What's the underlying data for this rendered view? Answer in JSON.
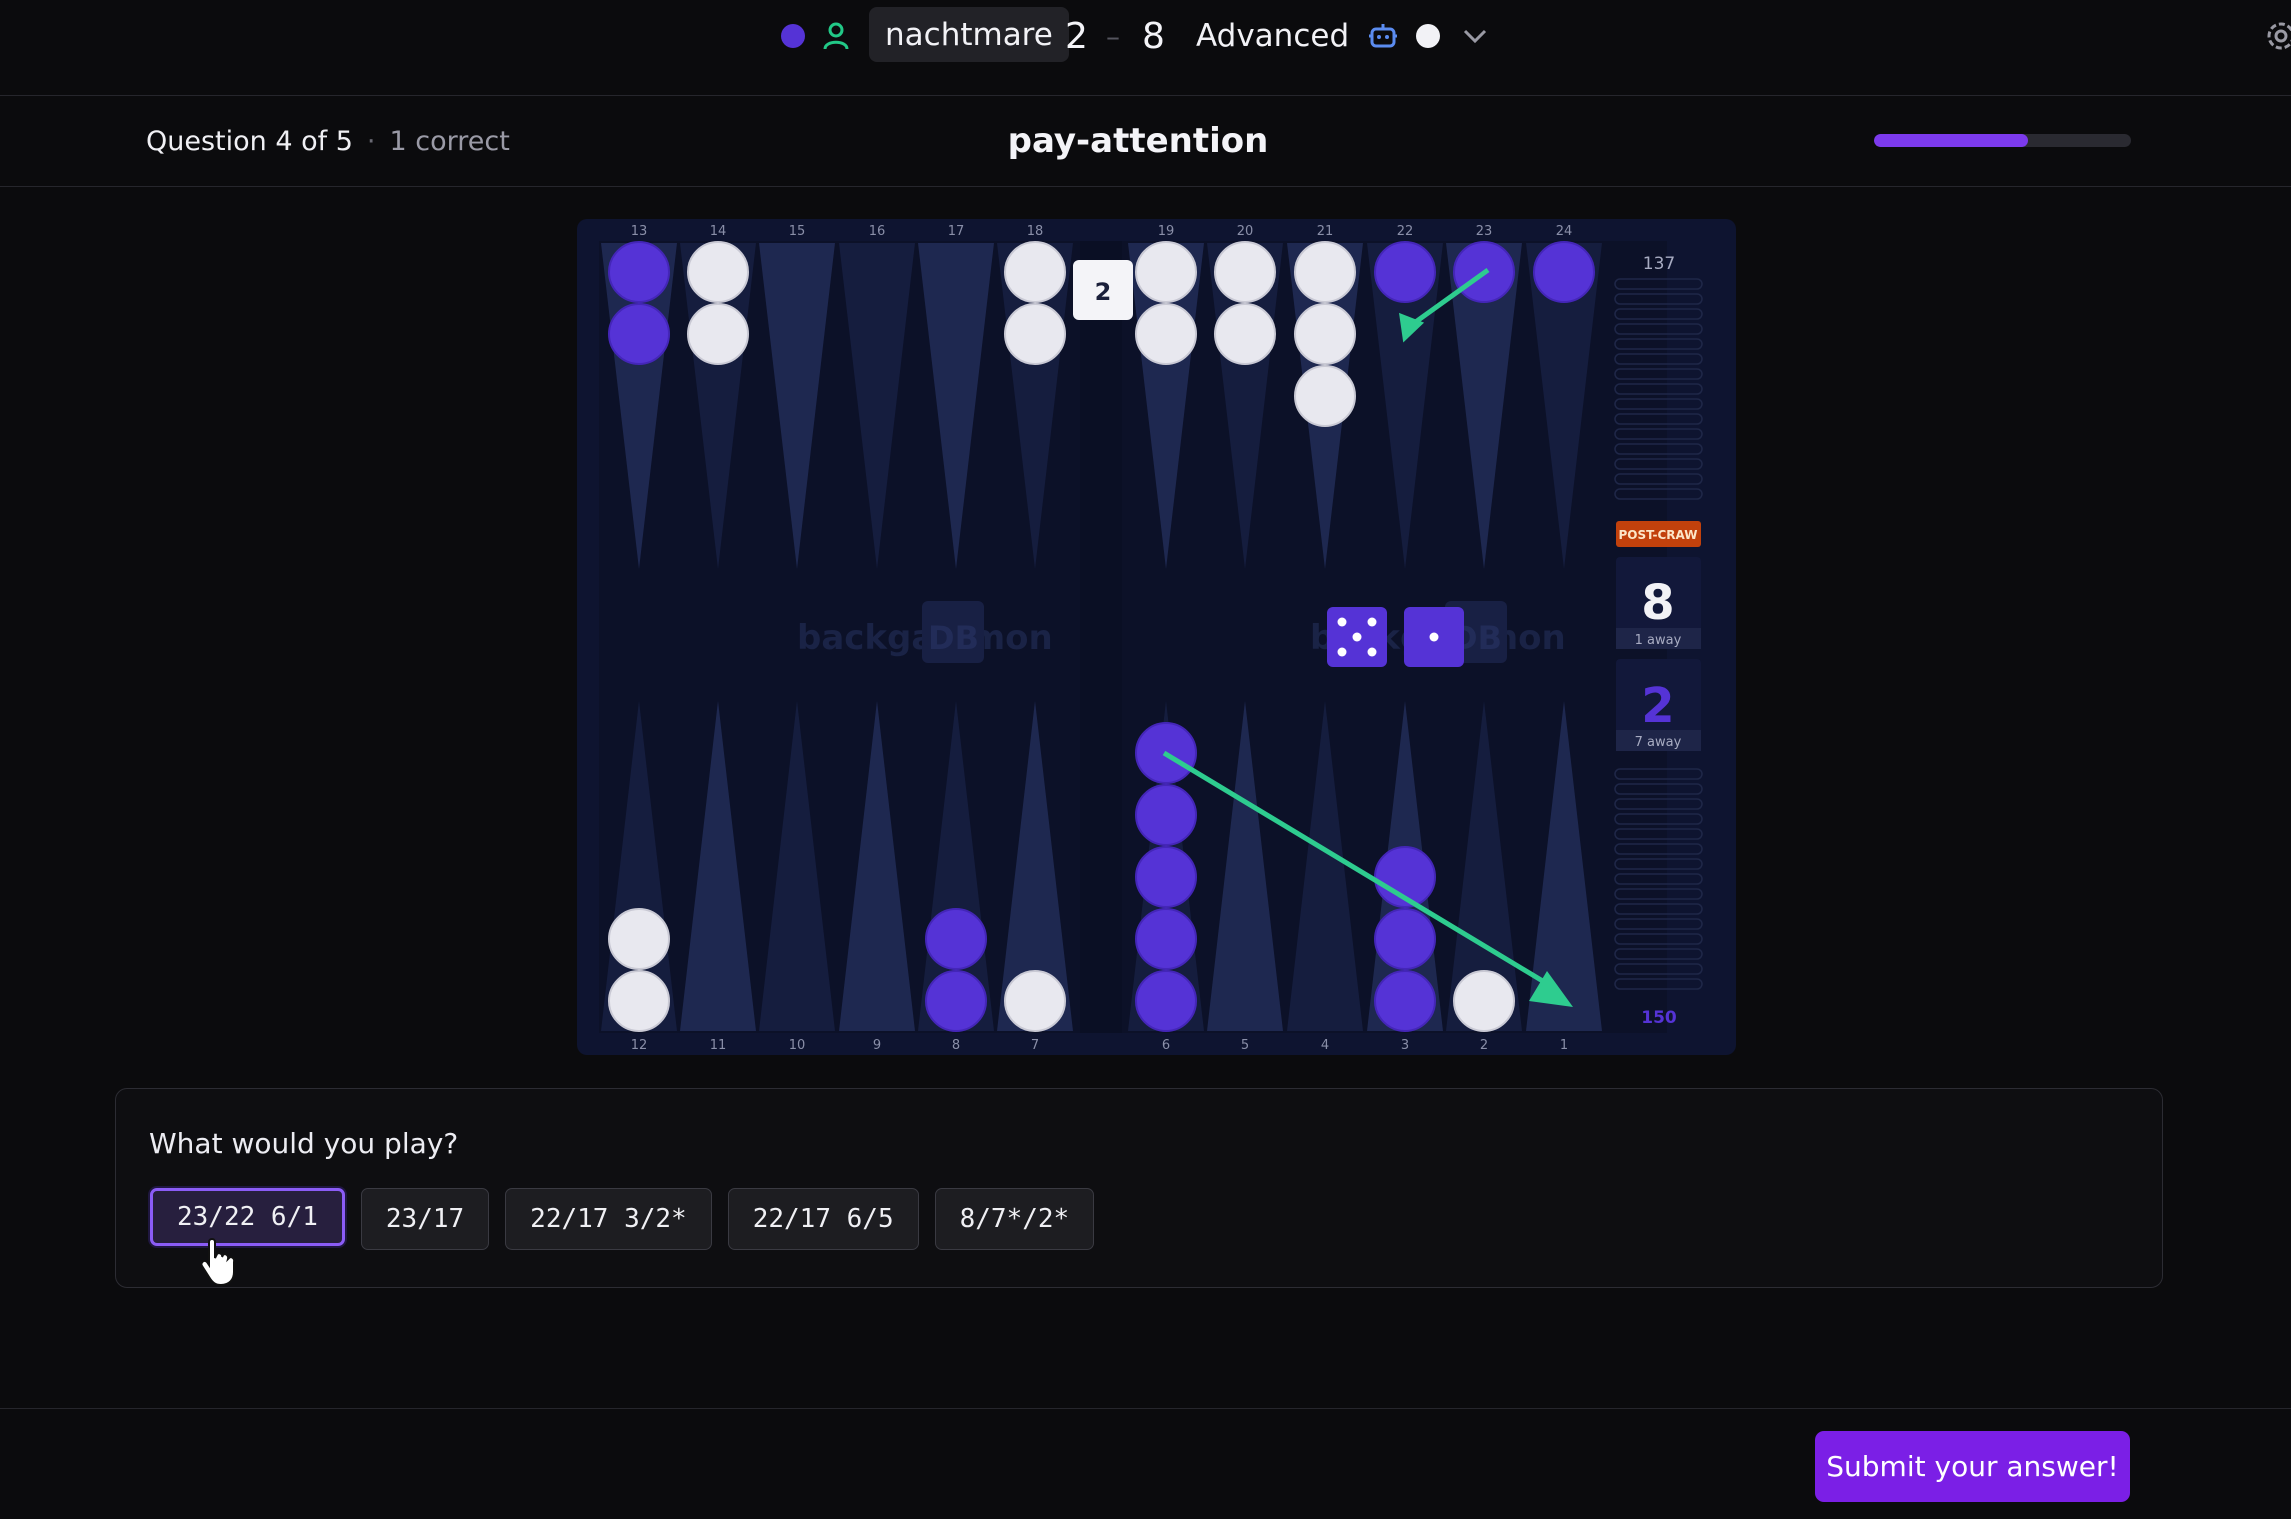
{
  "header": {
    "player_name": "nachtmare",
    "score_player": "2",
    "score_dash": "–",
    "score_opponent": "8",
    "level": "Advanced"
  },
  "question": {
    "progress_label": "Question 4 of 5",
    "separator": "·",
    "correct_label": "1 correct",
    "title": "pay-attention",
    "progress_fraction": 0.6
  },
  "board": {
    "top_points": [
      "13",
      "14",
      "15",
      "16",
      "17",
      "18",
      "19",
      "20",
      "21",
      "22",
      "23",
      "24"
    ],
    "bottom_points": [
      "12",
      "11",
      "10",
      "9",
      "8",
      "7",
      "6",
      "5",
      "4",
      "3",
      "2",
      "1"
    ],
    "cube_value": "2",
    "pip_top": "137",
    "pip_bottom": "150",
    "game_phase": "POST-CRAW",
    "score_top": "8",
    "score_top_away": "1 away",
    "score_bottom": "2",
    "score_bottom_away": "7 away",
    "watermark": "backgammon",
    "watermark_db": "DB",
    "dice": [
      5,
      1
    ],
    "colors": {
      "purple": "#5533d6",
      "white": "#e8e8ef",
      "arrow": "#2ecc8f"
    },
    "checkers": [
      {
        "point": 13,
        "color": "purple",
        "count": 2
      },
      {
        "point": 14,
        "color": "white",
        "count": 2
      },
      {
        "point": 18,
        "color": "white",
        "count": 2
      },
      {
        "point": 19,
        "color": "white",
        "count": 2
      },
      {
        "point": 20,
        "color": "white",
        "count": 2
      },
      {
        "point": 21,
        "color": "white",
        "count": 3
      },
      {
        "point": 22,
        "color": "purple",
        "count": 1
      },
      {
        "point": 23,
        "color": "purple",
        "count": 1
      },
      {
        "point": 24,
        "color": "purple",
        "count": 1
      },
      {
        "point": 12,
        "color": "white",
        "count": 2
      },
      {
        "point": 8,
        "color": "purple",
        "count": 2
      },
      {
        "point": 7,
        "color": "white",
        "count": 1
      },
      {
        "point": 6,
        "color": "purple",
        "count": 5
      },
      {
        "point": 3,
        "color": "purple",
        "count": 3
      },
      {
        "point": 2,
        "color": "white",
        "count": 1
      }
    ]
  },
  "answer_panel": {
    "prompt": "What would you play?",
    "options": [
      "23/22 6/1",
      "23/17",
      "22/17 3/2*",
      "22/17 6/5",
      "8/7*/2*"
    ],
    "selected_index": 0
  },
  "footer": {
    "submit_label": "Submit your answer!"
  }
}
